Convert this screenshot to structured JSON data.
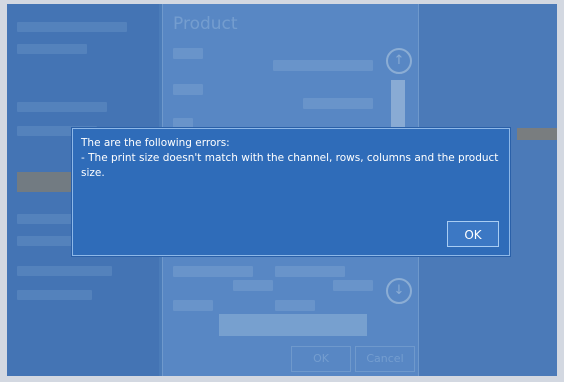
{
  "background": {
    "panel_title": "Product",
    "ok_label": "OK",
    "cancel_label": "Cancel",
    "accent_color": "#b8955a"
  },
  "dialog": {
    "message_line1": "The are the following errors:",
    "message_line2": " - The print size doesn't match with the channel, rows, columns and the product size.",
    "ok_label": "OK",
    "background_color": "#2f6cb9"
  }
}
